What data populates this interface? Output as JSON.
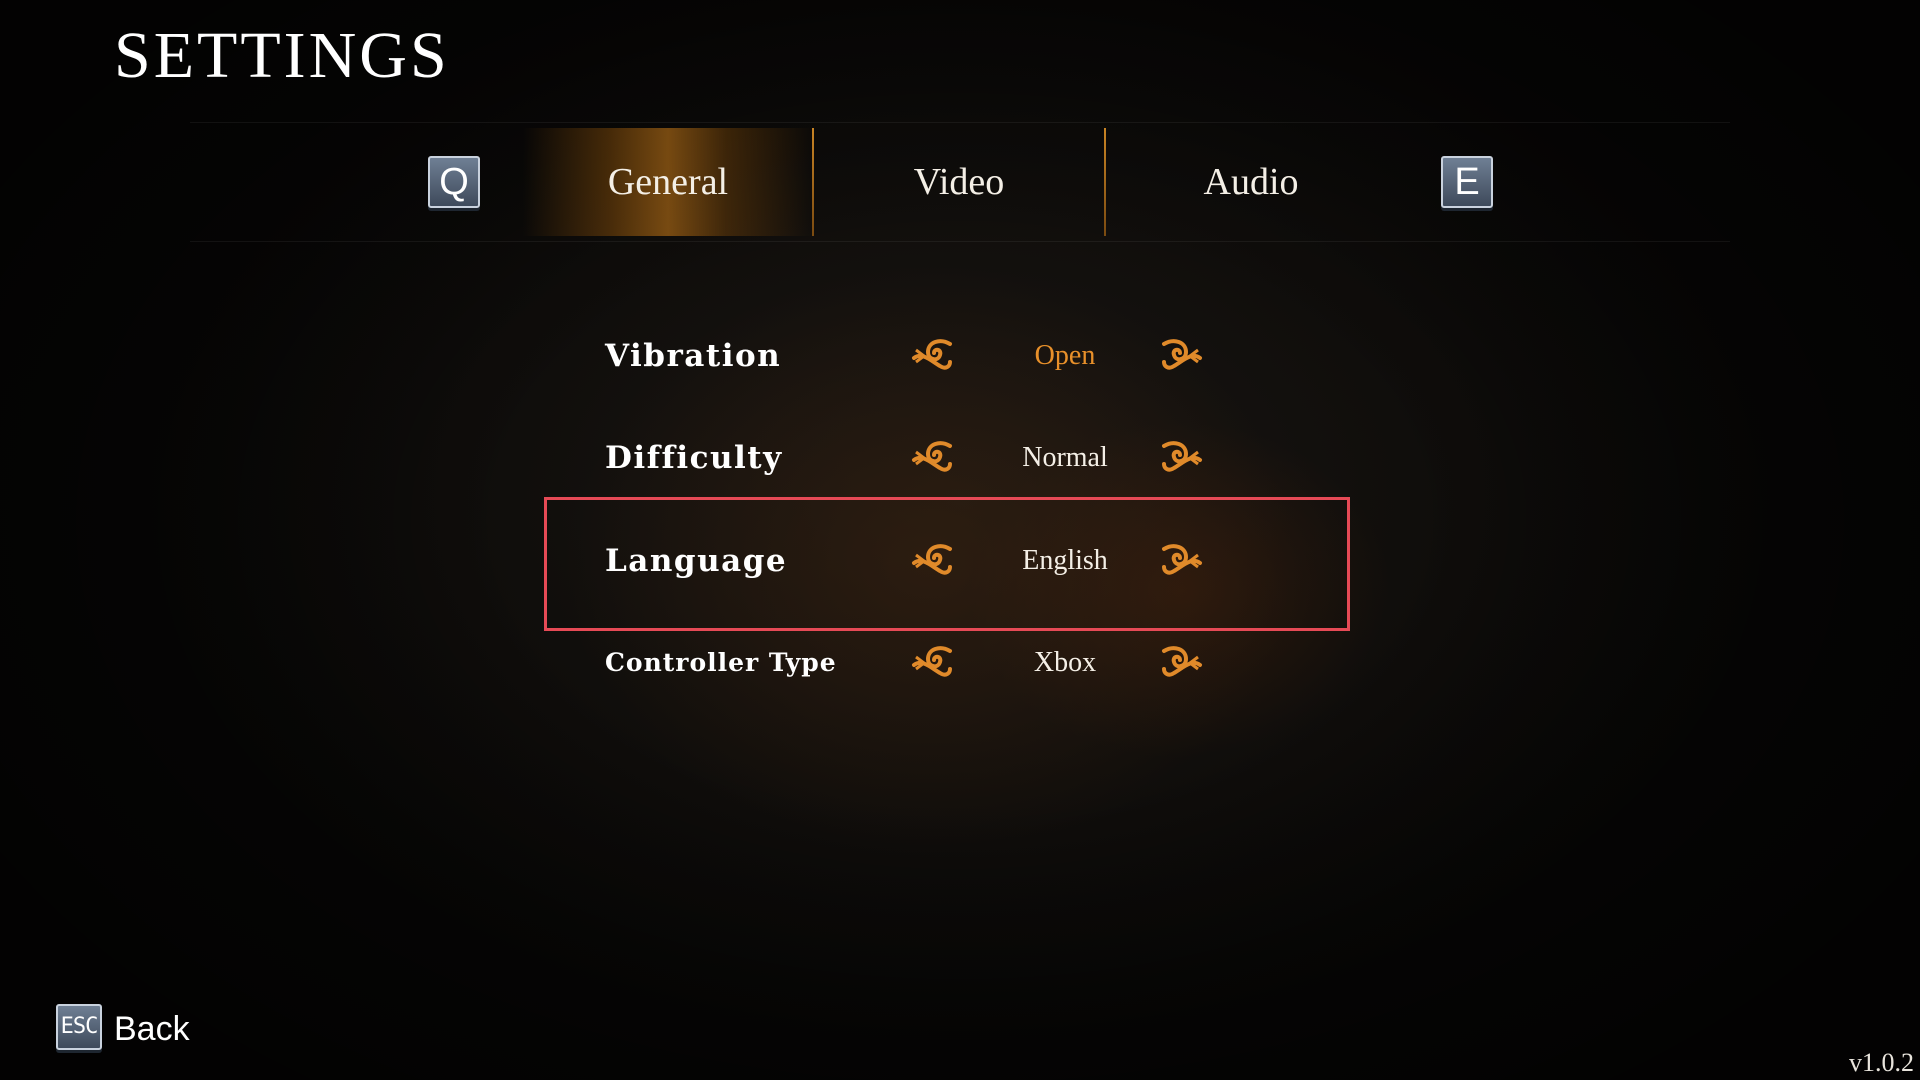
{
  "page": {
    "title": "SETTINGS"
  },
  "tabs": {
    "prev_key": "Q",
    "next_key": "E",
    "items": [
      {
        "label": "General",
        "active": true
      },
      {
        "label": "Video",
        "active": false
      },
      {
        "label": "Audio",
        "active": false
      }
    ]
  },
  "settings": [
    {
      "label": "Vibration",
      "value": "Open",
      "value_highlighted": true
    },
    {
      "label": "Difficulty",
      "value": "Normal",
      "value_highlighted": false
    },
    {
      "label": "Language",
      "value": "English",
      "value_highlighted": false,
      "selected": true
    },
    {
      "label": "Controller Type",
      "value": "Xbox",
      "value_highlighted": false
    }
  ],
  "footer": {
    "back_key": "ESC",
    "back_label": "Back",
    "version": "v1.0.2"
  },
  "icons": {
    "left_arrow": "ornate-swirl-left-icon",
    "right_arrow": "ornate-swirl-right-icon"
  },
  "colors": {
    "accent": "#e8902a",
    "selection_border": "#e64a56",
    "text": "#ffffff"
  }
}
